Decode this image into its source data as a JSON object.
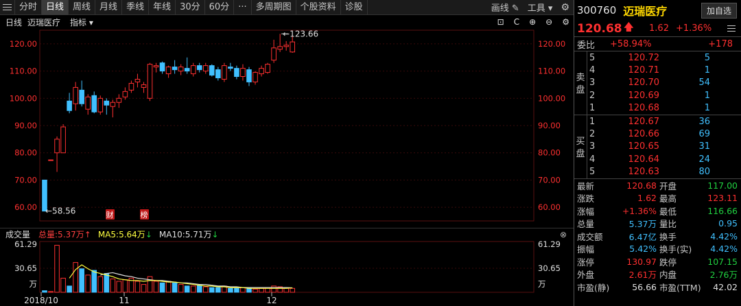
{
  "topbar": {
    "tabs": [
      "分时",
      "日线",
      "周线",
      "月线",
      "季线",
      "年线",
      "30分",
      "60分",
      "···",
      "多周期图",
      "个股资料",
      "诊股"
    ],
    "active_tab": 1,
    "draw_label": "画线",
    "tools_label": "工具"
  },
  "chart": {
    "period": "日线",
    "stock_name": "迈瑞医疗",
    "indicator": "指标 ▾",
    "controls": [
      "⊡",
      "C",
      "⊕",
      "⊖",
      "⚙"
    ],
    "marks": [
      "财",
      "榜"
    ]
  },
  "volume": {
    "label": "成交量",
    "total": "总量:5.37万↑",
    "ma5": "MA5:5.64万",
    "ma10": "MA10:5.71万"
  },
  "chart_data": {
    "type": "candlestick",
    "price_axis": {
      "ylim": [
        55,
        125
      ],
      "ticks": [
        "60.00",
        "70.00",
        "80.00",
        "90.00",
        "100.00",
        "110.00",
        "120.00"
      ],
      "tick_values": [
        60,
        70,
        80,
        90,
        100,
        110,
        120
      ]
    },
    "x_tick_labels": [
      "2018/10",
      "11",
      "12"
    ],
    "annotations": {
      "high": "123.66",
      "low": "58.56"
    },
    "candles": [
      {
        "o": 70.0,
        "h": 70.0,
        "l": 58.6,
        "c": 58.6
      },
      {
        "o": 77.4,
        "h": 77.4,
        "l": 77.4,
        "c": 77.4
      },
      {
        "o": 80.0,
        "h": 86.0,
        "l": 73.0,
        "c": 85.0
      },
      {
        "o": 80.0,
        "h": 90.5,
        "l": 80.0,
        "c": 89.5
      },
      {
        "o": 99.0,
        "h": 102.0,
        "l": 94.5,
        "c": 95.5
      },
      {
        "o": 98.0,
        "h": 106.0,
        "l": 95.5,
        "c": 104.0
      },
      {
        "o": 103.0,
        "h": 106.5,
        "l": 97.0,
        "c": 98.0
      },
      {
        "o": 96.0,
        "h": 101.5,
        "l": 94.0,
        "c": 100.5
      },
      {
        "o": 101.0,
        "h": 102.5,
        "l": 94.5,
        "c": 95.0
      },
      {
        "o": 95.0,
        "h": 101.0,
        "l": 94.0,
        "c": 100.0
      },
      {
        "o": 99.0,
        "h": 100.0,
        "l": 94.0,
        "c": 97.5
      },
      {
        "o": 97.0,
        "h": 99.5,
        "l": 93.0,
        "c": 98.5
      },
      {
        "o": 98.5,
        "h": 101.5,
        "l": 96.5,
        "c": 100.0
      },
      {
        "o": 100.5,
        "h": 104.0,
        "l": 99.5,
        "c": 102.5
      },
      {
        "o": 103.0,
        "h": 106.5,
        "l": 102.0,
        "c": 105.5
      },
      {
        "o": 106.0,
        "h": 109.0,
        "l": 104.0,
        "c": 107.0
      },
      {
        "o": 104.0,
        "h": 106.0,
        "l": 102.0,
        "c": 105.0
      },
      {
        "o": 100.0,
        "h": 113.0,
        "l": 99.0,
        "c": 112.5
      },
      {
        "o": 111.5,
        "h": 113.0,
        "l": 109.5,
        "c": 112.0
      },
      {
        "o": 113.0,
        "h": 113.5,
        "l": 109.0,
        "c": 110.0
      },
      {
        "o": 109.0,
        "h": 112.0,
        "l": 107.5,
        "c": 111.5
      },
      {
        "o": 111.5,
        "h": 114.0,
        "l": 109.0,
        "c": 110.5
      },
      {
        "o": 110.0,
        "h": 112.5,
        "l": 108.5,
        "c": 111.5
      },
      {
        "o": 111.0,
        "h": 115.0,
        "l": 109.0,
        "c": 110.0
      },
      {
        "o": 109.0,
        "h": 113.0,
        "l": 108.0,
        "c": 112.0
      },
      {
        "o": 112.0,
        "h": 113.0,
        "l": 109.5,
        "c": 110.5
      },
      {
        "o": 110.0,
        "h": 113.0,
        "l": 109.0,
        "c": 112.0
      },
      {
        "o": 112.0,
        "h": 112.5,
        "l": 108.0,
        "c": 108.5
      },
      {
        "o": 110.5,
        "h": 111.5,
        "l": 106.5,
        "c": 107.5
      },
      {
        "o": 107.0,
        "h": 113.0,
        "l": 106.0,
        "c": 112.0
      },
      {
        "o": 111.5,
        "h": 113.0,
        "l": 110.0,
        "c": 111.0
      },
      {
        "o": 111.0,
        "h": 112.0,
        "l": 107.0,
        "c": 108.0
      },
      {
        "o": 108.0,
        "h": 112.5,
        "l": 106.5,
        "c": 111.0
      },
      {
        "o": 110.5,
        "h": 111.5,
        "l": 104.5,
        "c": 106.0
      },
      {
        "o": 106.0,
        "h": 110.0,
        "l": 105.0,
        "c": 109.5
      },
      {
        "o": 109.0,
        "h": 112.0,
        "l": 108.0,
        "c": 111.0
      },
      {
        "o": 109.5,
        "h": 113.0,
        "l": 109.0,
        "c": 112.5
      },
      {
        "o": 114.0,
        "h": 121.5,
        "l": 113.0,
        "c": 118.5
      },
      {
        "o": 118.0,
        "h": 123.66,
        "l": 117.0,
        "c": 119.0
      },
      {
        "o": 119.0,
        "h": 121.0,
        "l": 117.5,
        "c": 119.5
      },
      {
        "o": 117.0,
        "h": 123.1,
        "l": 116.7,
        "c": 120.7
      }
    ],
    "volume_axis": {
      "ylim": [
        0,
        61.29
      ],
      "ticks": [
        "61.29",
        "30.65",
        "万"
      ],
      "tick_values": [
        61.29,
        30.65,
        0
      ]
    },
    "volumes": [
      2,
      1,
      60,
      18,
      8,
      38,
      30,
      22,
      28,
      20,
      24,
      17,
      14,
      16,
      18,
      14,
      10,
      20,
      14,
      12,
      14,
      12,
      10,
      8,
      8,
      9,
      7,
      6,
      6,
      8,
      5,
      5,
      6,
      5,
      4,
      5,
      6,
      8,
      7,
      5,
      5
    ],
    "ma5": [
      null,
      null,
      null,
      null,
      18,
      29,
      35,
      30,
      26,
      24,
      22,
      20,
      17,
      16,
      15,
      15,
      14,
      15,
      15,
      14,
      13,
      13,
      12,
      11,
      10,
      9,
      8,
      8,
      7,
      7,
      6,
      6,
      6,
      5,
      5,
      5,
      5,
      5,
      5,
      5,
      5.64
    ],
    "ma10": [
      null,
      null,
      null,
      null,
      null,
      null,
      null,
      null,
      null,
      22,
      24,
      25,
      23,
      21,
      20,
      18,
      17,
      16,
      15,
      15,
      14,
      13,
      12,
      12,
      11,
      10,
      10,
      9,
      8,
      8,
      7,
      7,
      6,
      6,
      6,
      6,
      6,
      6,
      6,
      6,
      5.71
    ]
  },
  "panel": {
    "code": "300760",
    "name": "迈瑞医疗",
    "add_button": "加自选",
    "price": "120.68",
    "change": "1.62",
    "change_pct": "+1.36%",
    "weibi_label": "委比",
    "weibi": "+58.94%",
    "weicha": "+178",
    "sell_label": "卖盘",
    "buy_label": "买盘",
    "sells": [
      {
        "lv": "5",
        "price": "120.72",
        "qty": "5"
      },
      {
        "lv": "4",
        "price": "120.71",
        "qty": "1"
      },
      {
        "lv": "3",
        "price": "120.70",
        "qty": "54"
      },
      {
        "lv": "2",
        "price": "120.69",
        "qty": "1"
      },
      {
        "lv": "1",
        "price": "120.68",
        "qty": "1"
      }
    ],
    "buys": [
      {
        "lv": "1",
        "price": "120.67",
        "qty": "36"
      },
      {
        "lv": "2",
        "price": "120.66",
        "qty": "69"
      },
      {
        "lv": "3",
        "price": "120.65",
        "qty": "31"
      },
      {
        "lv": "4",
        "price": "120.64",
        "qty": "24"
      },
      {
        "lv": "5",
        "price": "120.63",
        "qty": "80"
      }
    ],
    "stats": [
      {
        "k1": "最新",
        "v1": "120.68",
        "c1": "red",
        "k2": "开盘",
        "v2": "117.00",
        "c2": "green"
      },
      {
        "k1": "涨跌",
        "v1": "1.62",
        "c1": "red",
        "k2": "最高",
        "v2": "123.11",
        "c2": "red"
      },
      {
        "k1": "涨幅",
        "v1": "+1.36%",
        "c1": "red",
        "k2": "最低",
        "v2": "116.66",
        "c2": "green"
      },
      {
        "k1": "总量",
        "v1": "5.37万",
        "c1": "cyan",
        "k2": "量比",
        "v2": "0.95",
        "c2": "cyan"
      },
      {
        "k1": "成交额",
        "v1": "6.47亿",
        "c1": "cyan",
        "k2": "换手",
        "v2": "4.42%",
        "c2": "cyan"
      },
      {
        "k1": "振幅",
        "v1": "5.42%",
        "c1": "cyan",
        "k2": "换手(实)",
        "v2": "4.42%",
        "c2": "cyan"
      },
      {
        "k1": "涨停",
        "v1": "130.97",
        "c1": "red",
        "k2": "跌停",
        "v2": "107.15",
        "c2": "green"
      },
      {
        "k1": "外盘",
        "v1": "2.61万",
        "c1": "red",
        "k2": "内盘",
        "v2": "2.76万",
        "c2": "green"
      },
      {
        "k1": "市盈(静)",
        "v1": "56.66",
        "c1": "white",
        "k2": "市盈(TTM)",
        "v2": "42.02",
        "c2": "white"
      }
    ]
  },
  "colors": {
    "up": "#ff3030",
    "down": "#40c0ff",
    "ma5": "#ffff40",
    "ma10": "#e0e0e0",
    "axis": "#ff3030"
  }
}
